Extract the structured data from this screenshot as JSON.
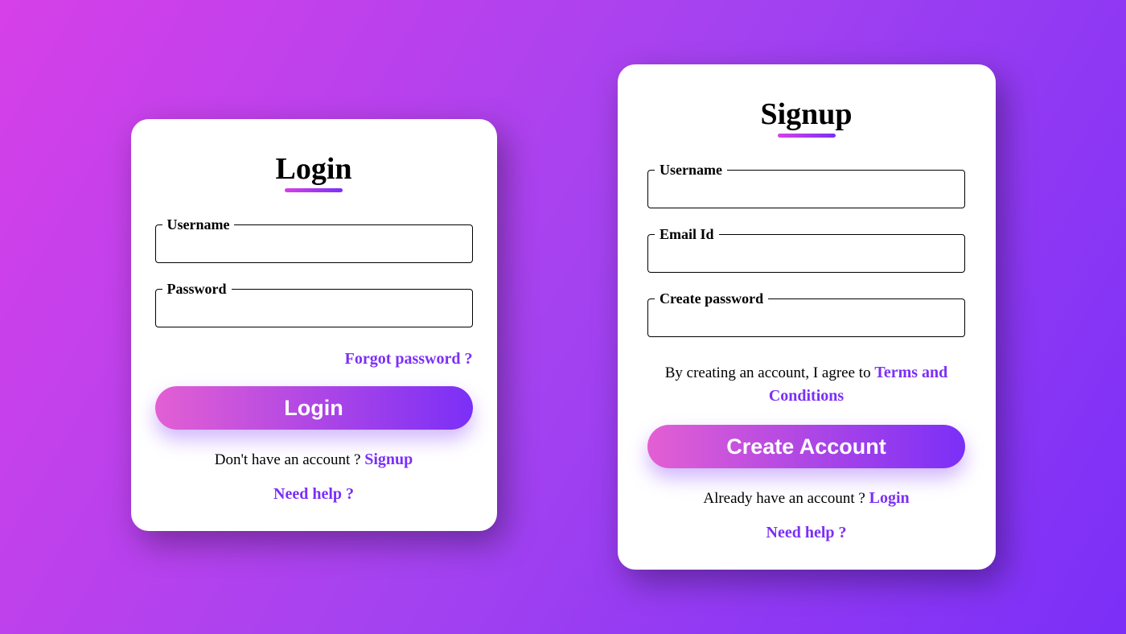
{
  "login": {
    "title": "Login",
    "username_label": "Username",
    "password_label": "Password",
    "forgot_link": "Forgot password ?",
    "button_label": "Login",
    "no_account_text": "Don't have an account ? ",
    "signup_link": "Signup",
    "help_link": "Need help ?"
  },
  "signup": {
    "title": "Signup",
    "username_label": "Username",
    "email_label": "Email Id",
    "password_label": "Create password",
    "agree_text": "By creating an account, I agree to ",
    "terms_link": "Terms and Conditions",
    "button_label": "Create Account",
    "have_account_text": "Already have an account ? ",
    "login_link": "Login",
    "help_link": "Need help ?"
  }
}
